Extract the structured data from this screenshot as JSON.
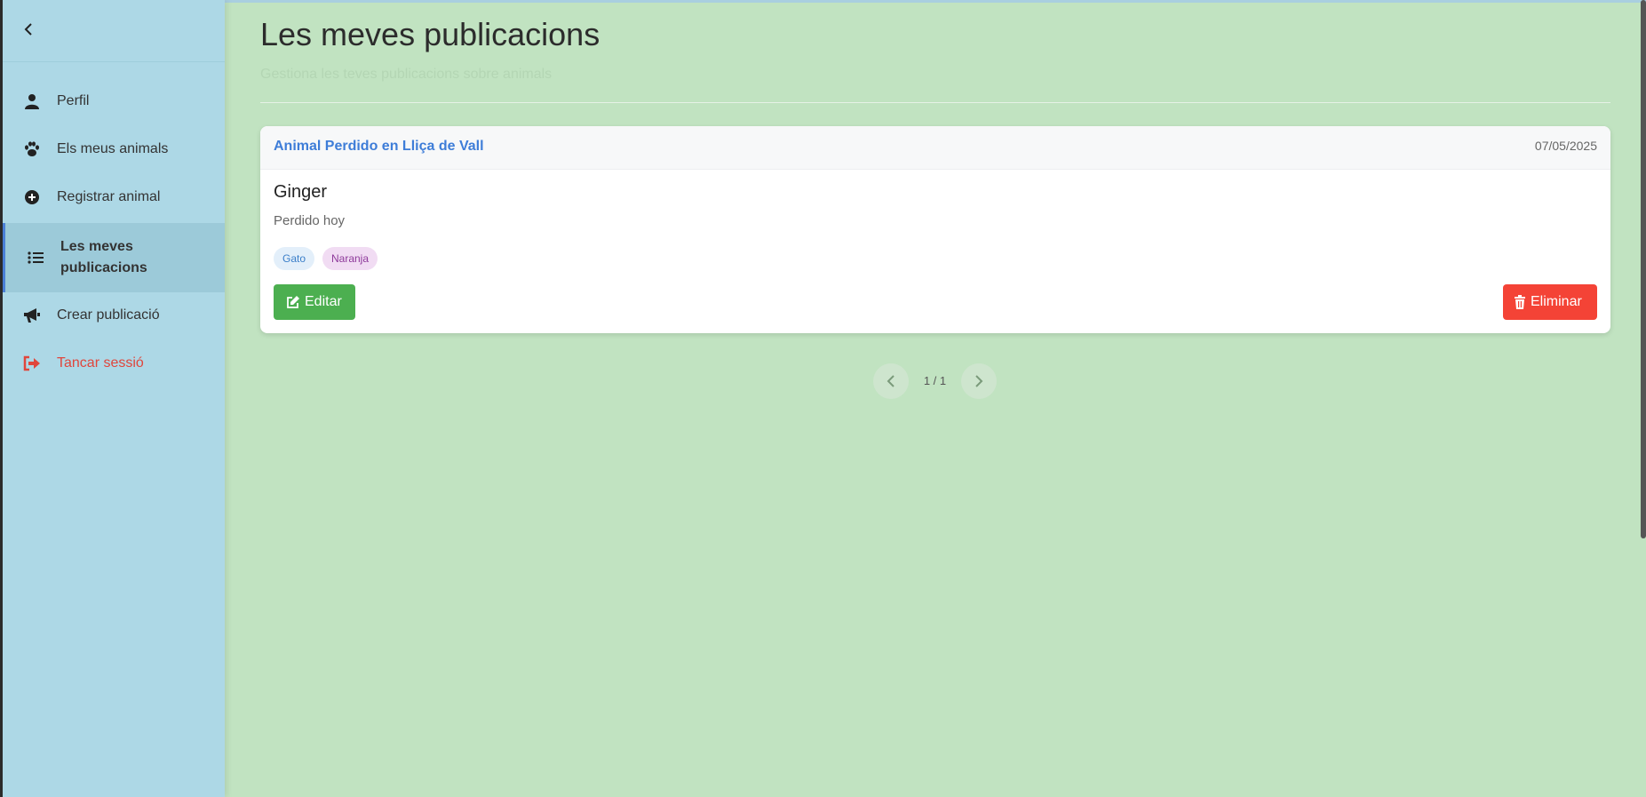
{
  "sidebar": {
    "collapse_icon": "chevron-left-icon",
    "items": [
      {
        "label": "Perfil",
        "icon": "user-icon"
      },
      {
        "label": "Els meus animals",
        "icon": "paw-icon"
      },
      {
        "label": "Registrar animal",
        "icon": "plus-circle-icon"
      },
      {
        "label": "Les meves publicacions",
        "icon": "list-icon",
        "active": true
      },
      {
        "label": "Crear publicació",
        "icon": "megaphone-icon"
      },
      {
        "label": "Tancar sessió",
        "icon": "logout-icon"
      }
    ]
  },
  "main": {
    "title": "Les meves publicacions",
    "subtitle": "Gestiona les teves publicacions sobre animals"
  },
  "posts": [
    {
      "title": "Animal Perdido en Lliça de Vall",
      "date": "07/05/2025",
      "animal_name": "Ginger",
      "description": "Perdido hoy",
      "tags": [
        "Gato",
        "Naranja"
      ],
      "edit_label": "Editar",
      "delete_label": "Eliminar"
    }
  ],
  "pagination": {
    "indicator": "1 / 1"
  },
  "colors": {
    "sidebar_bg": "#add8e6",
    "main_bg": "#c1e3c1",
    "accent_blue": "#3e7dd8",
    "edit_green": "#4caf50",
    "delete_red": "#f44336",
    "logout_red": "#e0463c"
  }
}
